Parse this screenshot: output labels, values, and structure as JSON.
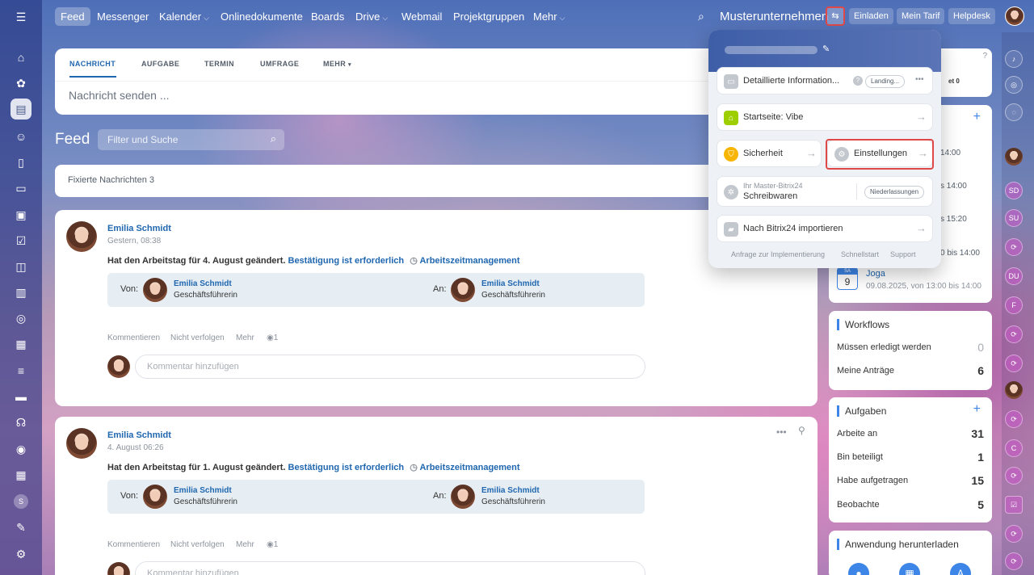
{
  "topbar": {
    "nav": [
      "Feed",
      "Messenger",
      "Kalender",
      "Onlinedokumente",
      "Boards",
      "Drive",
      "Webmail",
      "Projektgruppen",
      "Mehr"
    ],
    "company": "Musterunternehmen",
    "invite": "Einladen",
    "plan": "Mein Tarif",
    "helpdesk": "Helpdesk"
  },
  "composer": {
    "tabs": [
      "NACHRICHT",
      "AUFGABE",
      "TERMIN",
      "UMFRAGE",
      "MEHR"
    ],
    "placeholder": "Nachricht senden ..."
  },
  "feed": {
    "title": "Feed",
    "filter_placeholder": "Filter und Suche",
    "pinned": "Fixierte Nachrichten",
    "pinned_count": "3"
  },
  "posts": [
    {
      "author": "Emilia Schmidt",
      "time": "Gestern, 08:38",
      "text": "Hat den Arbeitstag für 4. August geändert.",
      "confirm": "Bestätigung ist erforderlich",
      "category": "Arbeitszeitmanagement",
      "from_label": "Von:",
      "from_name": "Emilia Schmidt",
      "from_role": "Geschäftsführerin",
      "to_label": "An:",
      "to_name": "Emilia Schmidt",
      "to_role": "Geschäftsführerin",
      "actions": [
        "Kommentieren",
        "Nicht verfolgen",
        "Mehr"
      ],
      "views": "1",
      "comment_placeholder": "Kommentar hinzufügen"
    },
    {
      "author": "Emilia Schmidt",
      "time": "4. August 06:26",
      "text": "Hat den Arbeitstag für 1. August geändert.",
      "confirm": "Bestätigung ist erforderlich",
      "category": "Arbeitszeitmanagement",
      "from_label": "Von:",
      "from_name": "Emilia Schmidt",
      "from_role": "Geschäftsführerin",
      "to_label": "An:",
      "to_name": "Emilia Schmidt",
      "to_role": "Geschäftsführerin",
      "actions": [
        "Kommentieren",
        "Nicht verfolgen",
        "Mehr"
      ],
      "views": "1",
      "comment_placeholder": "Kommentar hinzufügen"
    }
  ],
  "popup": {
    "detail": "Detaillierte Information...",
    "landing": "Landing...",
    "startpage": "Startseite: Vibe",
    "security": "Sicherheit",
    "settings": "Einstellungen",
    "master_label": "Ihr Master-Bitrix24",
    "master_name": "Schreibwaren",
    "branches": "Niederlassungen",
    "import": "Nach Bitrix24 importieren",
    "footer": [
      "Anfrage zur Implementierung",
      "Schnellstart",
      "Support"
    ]
  },
  "events": {
    "partial": [
      {
        "text": "14:00"
      },
      {
        "text": "s 14:00"
      },
      {
        "text": "s 15:20"
      },
      {
        "text": "0 bis 14:00"
      }
    ],
    "item": {
      "weekday": "SA",
      "day": "9",
      "title": "Joga",
      "time": "09.08.2025, von 13:00 bis 14:00"
    },
    "partial_top": "et 0"
  },
  "workflows": {
    "title": "Workflows",
    "rows": [
      {
        "label": "Müssen erledigt werden",
        "value": "0"
      },
      {
        "label": "Meine Anträge",
        "value": "6"
      }
    ]
  },
  "tasks": {
    "title": "Aufgaben",
    "rows": [
      {
        "label": "Arbeite an",
        "value": "31"
      },
      {
        "label": "Bin beteiligt",
        "value": "1"
      },
      {
        "label": "Habe aufgetragen",
        "value": "15"
      },
      {
        "label": "Beobachte",
        "value": "5"
      }
    ]
  },
  "download": {
    "title": "Anwendung herunterladen"
  },
  "rstrip": [
    "SD",
    "SU",
    "DU",
    "F",
    "C"
  ],
  "sidebar_user": "S"
}
